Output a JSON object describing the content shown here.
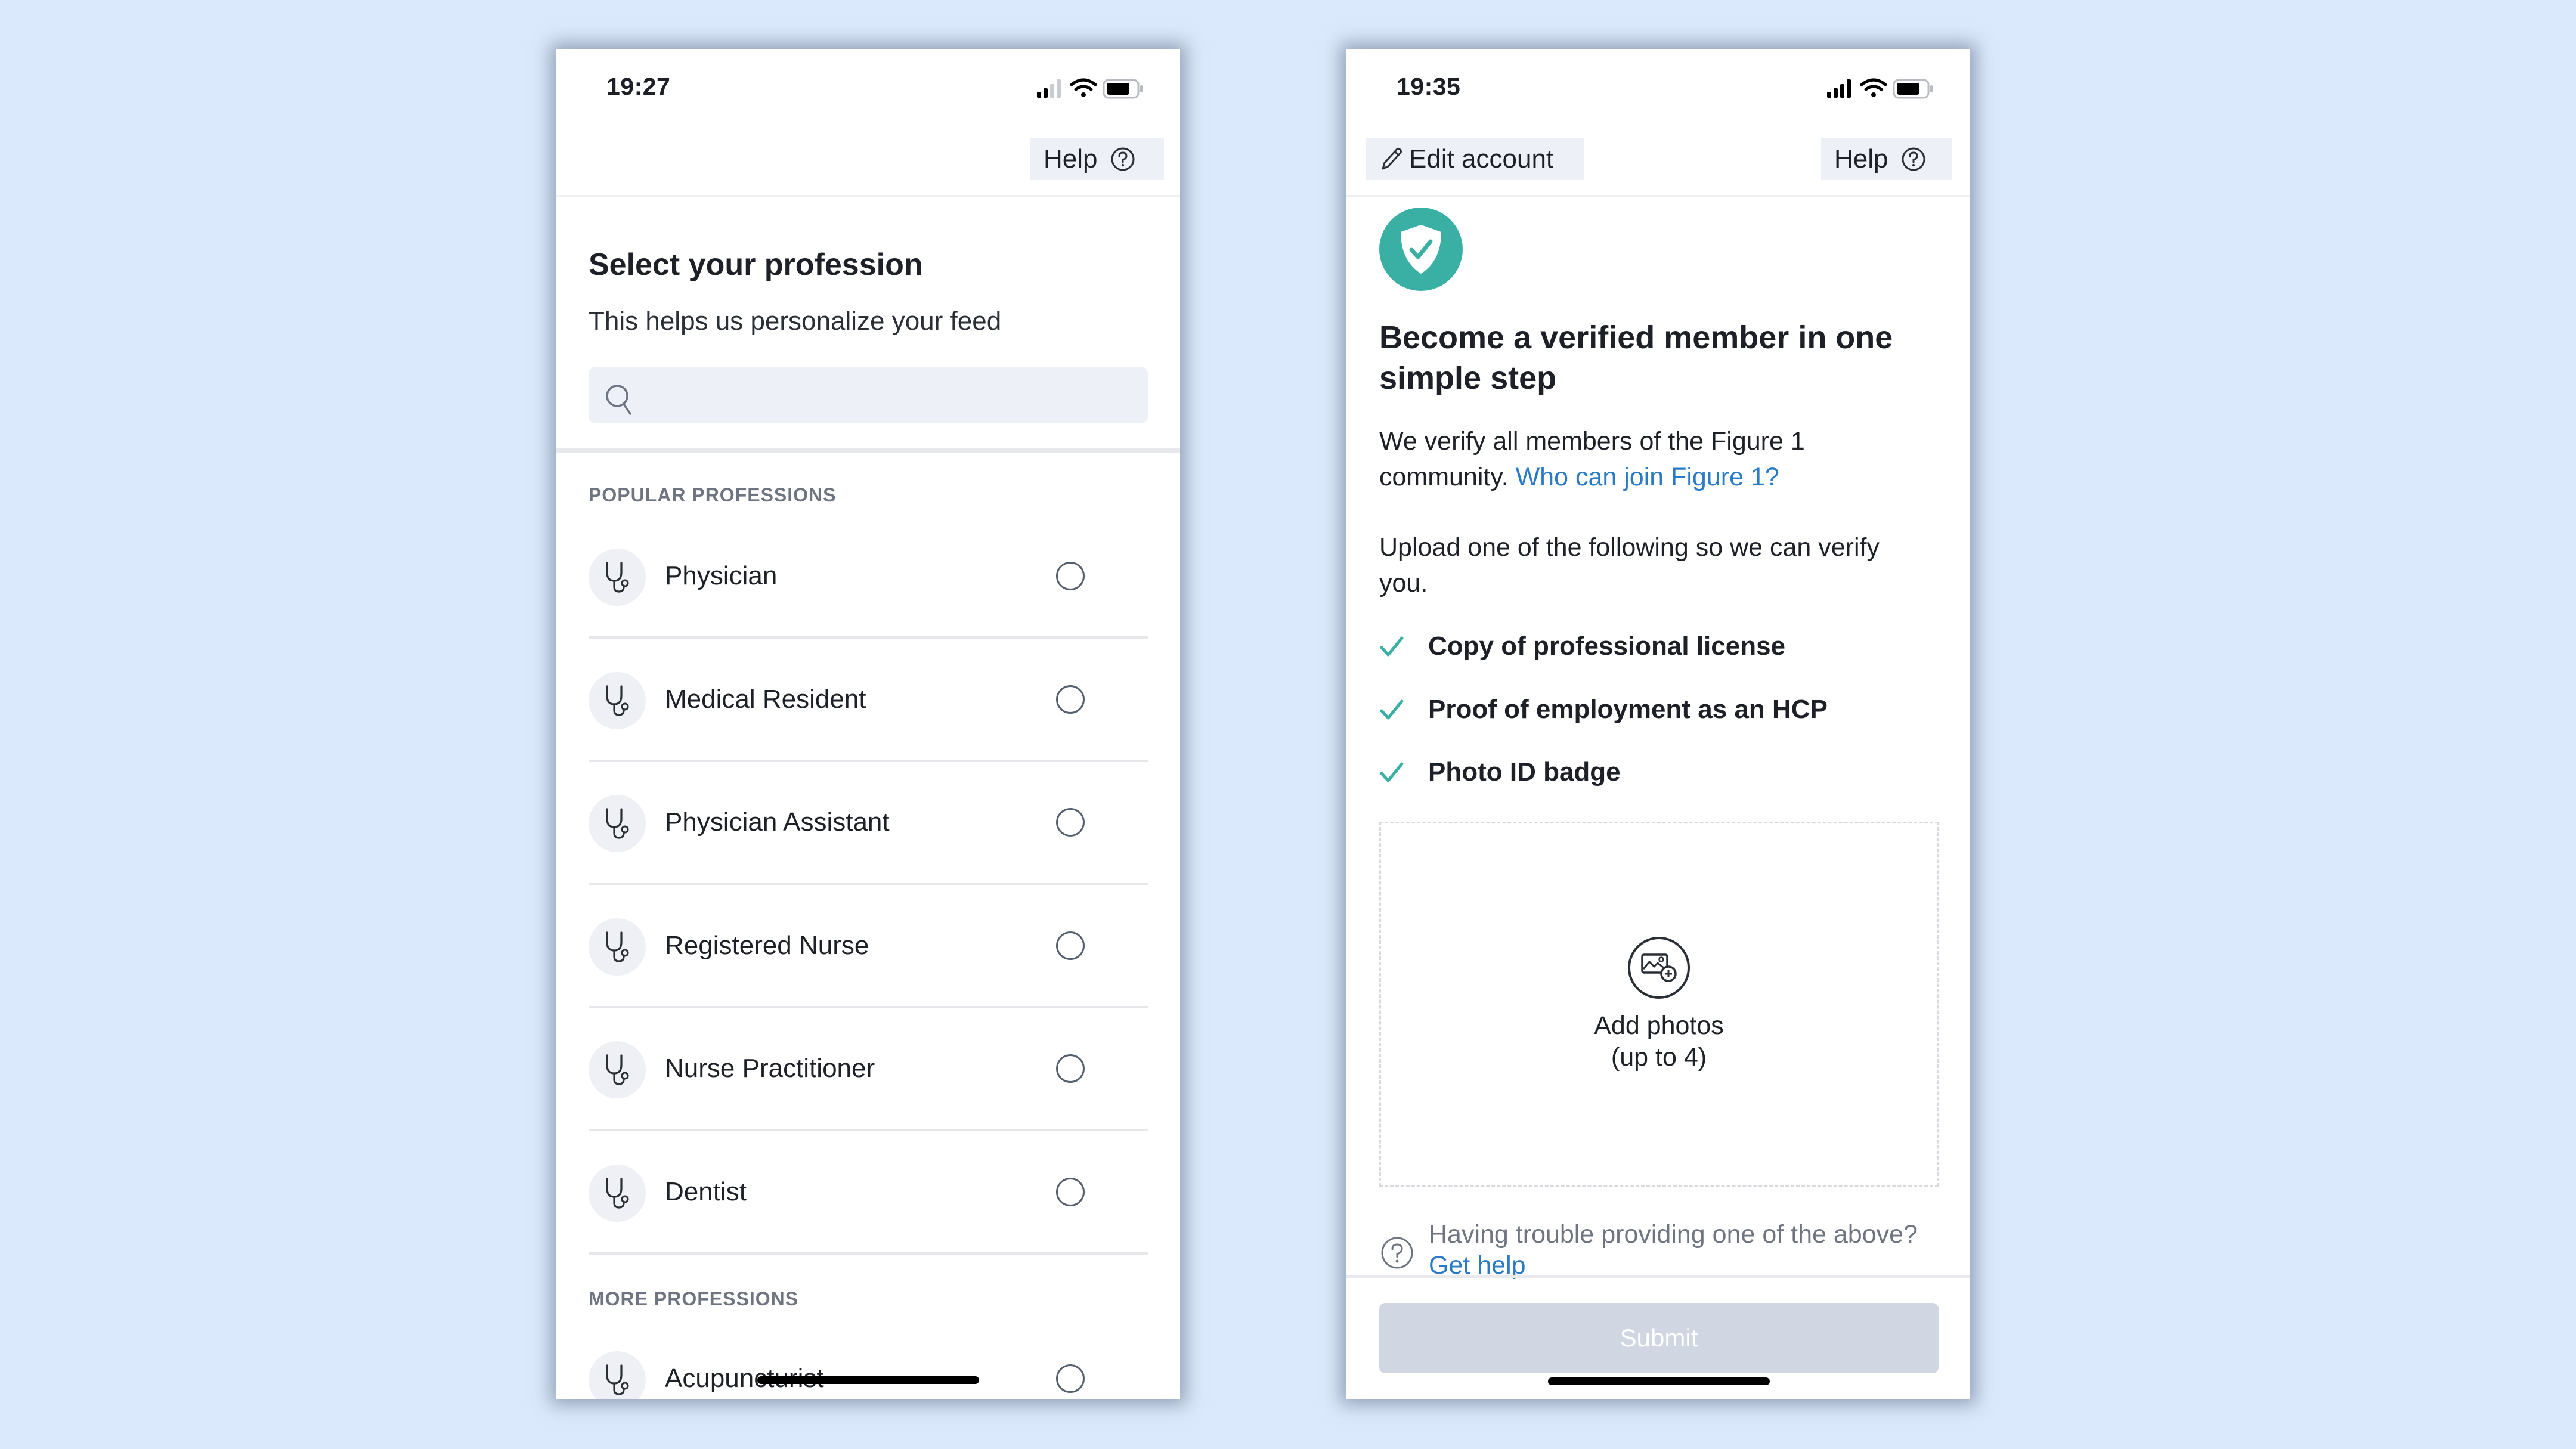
{
  "background_color": "#DBE9FC",
  "colors": {
    "accent_teal": "#3AAFA4",
    "link_blue": "#2A7BC7",
    "button_bg": "#EDF0F6",
    "submit_disabled": "#D0D7E3"
  },
  "left_screen": {
    "status_bar": {
      "time": "19:27",
      "icons": [
        "signal-icon",
        "wifi-icon",
        "battery-icon"
      ]
    },
    "header": {
      "help_label": "Help"
    },
    "title": "Select your profession",
    "subtitle": "This helps us personalize your feed",
    "search": {
      "placeholder": "",
      "value": ""
    },
    "popular_section_label": "POPULAR PROFESSIONS",
    "popular_professions": [
      {
        "label": "Physician",
        "selected": false,
        "icon": "stethoscope-icon"
      },
      {
        "label": "Medical Resident",
        "selected": false,
        "icon": "stethoscope-icon"
      },
      {
        "label": "Physician Assistant",
        "selected": false,
        "icon": "stethoscope-icon"
      },
      {
        "label": "Registered Nurse",
        "selected": false,
        "icon": "stethoscope-icon"
      },
      {
        "label": "Nurse Practitioner",
        "selected": false,
        "icon": "stethoscope-icon"
      },
      {
        "label": "Dentist",
        "selected": false,
        "icon": "stethoscope-icon"
      }
    ],
    "more_section_label": "MORE PROFESSIONS",
    "more_professions": [
      {
        "label": "Acupuncturist",
        "selected": false,
        "icon": "stethoscope-icon"
      }
    ]
  },
  "right_screen": {
    "status_bar": {
      "time": "19:35",
      "icons": [
        "signal-icon",
        "wifi-icon",
        "battery-icon"
      ]
    },
    "header": {
      "edit_account_label": "Edit account",
      "help_label": "Help"
    },
    "title": "Become a verified member in one simple step",
    "intro_text": "We verify all members of the Figure 1 community.",
    "intro_link": "Who can join Figure 1?",
    "upload_text": "Upload one of the following so we can verify you.",
    "requirements": [
      "Copy of professional license",
      "Proof of employment as an HCP",
      "Photo ID badge"
    ],
    "dropzone": {
      "line1": "Add photos",
      "line2": "(up to 4)"
    },
    "trouble_text": "Having trouble providing one of the above?",
    "trouble_link": "Get help",
    "submit_label": "Submit",
    "submit_enabled": false
  }
}
